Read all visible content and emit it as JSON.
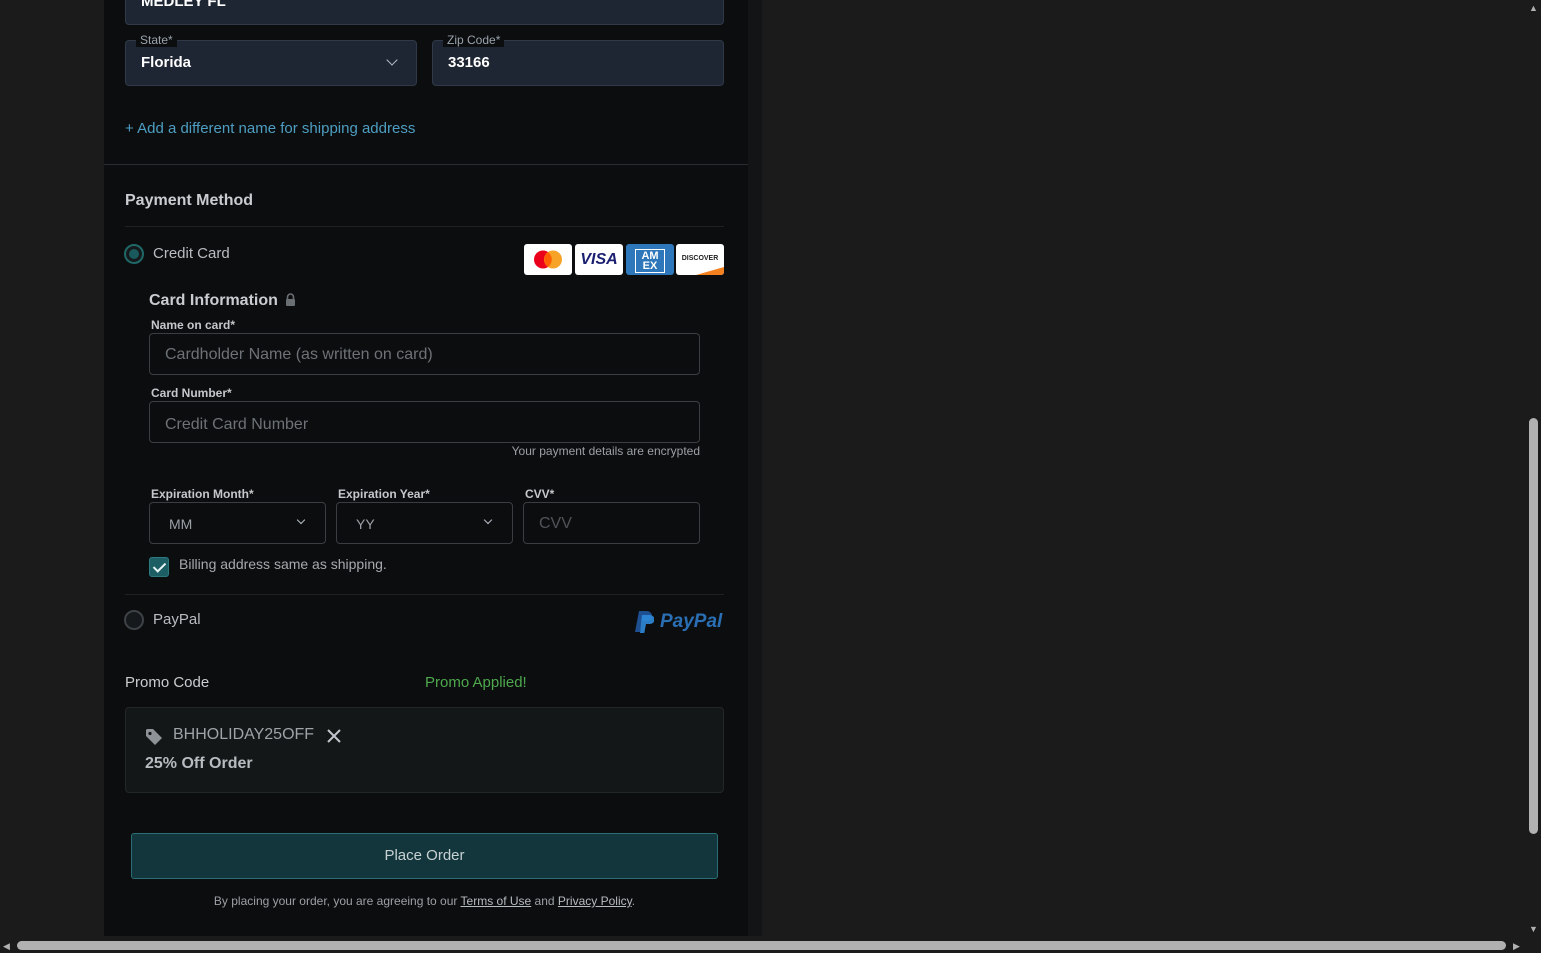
{
  "address": {
    "city_value": "MEDLEY FL",
    "state_label": "State*",
    "state_value": "Florida",
    "zip_label": "Zip Code*",
    "zip_value": "33166",
    "add_name_link": "+ Add a different name for shipping address"
  },
  "payment": {
    "title": "Payment Method",
    "credit_card_label": "Credit Card",
    "card_brands": [
      "mastercard-logo",
      "visa-logo",
      "amex-logo",
      "discover-logo"
    ],
    "visa_text": "VISA",
    "amex_text": "AM EX",
    "discover_text": "DISCOVER",
    "card_info_title": "Card Information",
    "name_label": "Name on card*",
    "name_placeholder": "Cardholder Name (as written on card)",
    "number_label": "Card Number*",
    "number_placeholder": "Credit Card Number",
    "encrypted_note": "Your payment details are encrypted",
    "exp_month_label": "Expiration Month*",
    "exp_month_value": "MM",
    "exp_year_label": "Expiration Year*",
    "exp_year_value": "YY",
    "cvv_label": "CVV*",
    "cvv_placeholder": "CVV",
    "billing_same_label": "Billing address same as shipping.",
    "paypal_label": "PayPal",
    "paypal_logo_text": "PayPal"
  },
  "promo": {
    "label": "Promo Code",
    "status": "Promo Applied!",
    "code": "BHHOLIDAY25OFF",
    "description": "25% Off Order"
  },
  "order": {
    "place_order_label": "Place Order",
    "legal_prefix": "By placing your order, you are agreeing to our ",
    "terms_link": "Terms of Use",
    "legal_and": " and ",
    "privacy_link": "Privacy Policy",
    "legal_suffix": "."
  },
  "colors": {
    "accent_teal": "#4d9ec2",
    "promo_green": "#4ea84d",
    "button_bg": "#12363b"
  }
}
